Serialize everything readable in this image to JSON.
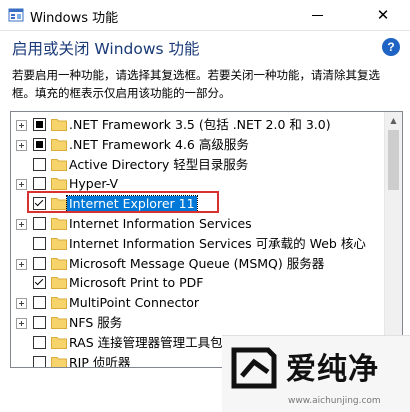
{
  "window": {
    "title": "Windows 功能",
    "close_glyph": "✕"
  },
  "header": {
    "heading": "启用或关闭 Windows 功能",
    "help_glyph": "?",
    "description_line1": "若要启用一种功能，请选择其复选框。若要关闭一种功能，请清除其复选",
    "description_line2": "框。填充的框表示仅启用该功能的一部分。"
  },
  "features": [
    {
      "label": ".NET Framework 3.5 (包括 .NET 2.0 和 3.0)",
      "expandable": true,
      "state": "partial"
    },
    {
      "label": ".NET Framework 4.6 高级服务",
      "expandable": true,
      "state": "partial"
    },
    {
      "label": "Active Directory 轻型目录服务",
      "expandable": false,
      "state": "unchecked"
    },
    {
      "label": "Hyper-V",
      "expandable": true,
      "state": "unchecked"
    },
    {
      "label": "Internet Explorer 11",
      "expandable": false,
      "state": "checked",
      "selected": true
    },
    {
      "label": "Internet Information Services",
      "expandable": true,
      "state": "unchecked"
    },
    {
      "label": "Internet Information Services 可承载的 Web 核心",
      "expandable": false,
      "state": "unchecked"
    },
    {
      "label": "Microsoft Message Queue (MSMQ) 服务器",
      "expandable": true,
      "state": "unchecked"
    },
    {
      "label": "Microsoft Print to PDF",
      "expandable": false,
      "state": "checked"
    },
    {
      "label": "MultiPoint Connector",
      "expandable": true,
      "state": "unchecked"
    },
    {
      "label": "NFS 服务",
      "expandable": true,
      "state": "unchecked"
    },
    {
      "label": "RAS 连接管理器管理工具包(CMAK)",
      "expandable": false,
      "state": "unchecked"
    },
    {
      "label": "RIP 侦听器",
      "expandable": false,
      "state": "unchecked"
    }
  ],
  "watermark": {
    "brand": "爱纯净",
    "url": "www.aichunjing.com"
  },
  "colors": {
    "selection": "#0078d7",
    "heading": "#1a3a78",
    "highlight_frame": "#d9312f",
    "folder": "#f6d36b"
  }
}
